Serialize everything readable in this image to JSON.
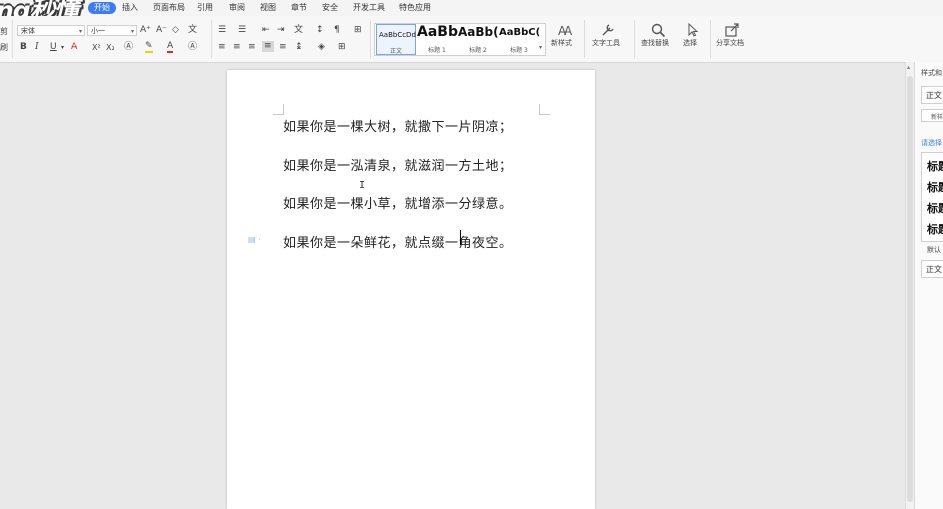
{
  "watermark": "ng秒懂",
  "menu": {
    "items": [
      "开始",
      "插入",
      "页面布局",
      "引用",
      "审阅",
      "视图",
      "章节",
      "安全",
      "开发工具",
      "特色应用"
    ],
    "active": "开始"
  },
  "ribbon": {
    "left_stub_top": "剪",
    "left_stub_bottom": "刷",
    "font_name": "宋体",
    "font_size": "小一",
    "grow_font": "A⁺",
    "shrink_font": "A⁻",
    "bold": "B",
    "italic": "I",
    "underline": "U",
    "font_color": "A",
    "superscript": "X²",
    "subscript": "X₂",
    "styles": [
      {
        "sample": "AaBbCcDd",
        "name": "正文"
      },
      {
        "sample": "AaBb",
        "name": "标题 1"
      },
      {
        "sample": "AaBb(",
        "name": "标题 2"
      },
      {
        "sample": "AaBbC(",
        "name": "标题 3"
      }
    ],
    "new_style": "新样式",
    "text_tool": "文字工具",
    "find_replace": "查找替换",
    "select": "选择",
    "share_doc": "分享文档"
  },
  "document": {
    "paragraphs": [
      "如果你是一棵大树，就撒下一片阴凉；",
      "如果你是一泓清泉，就滋润一方土地；",
      "如果你是一棵小草，就增添一分绿意。",
      "如果你是一朵鲜花，就点缀一角夜空。"
    ]
  },
  "side_panel": {
    "title": "样式和",
    "current_style": "正文",
    "new_button": "新样",
    "choose_label": "请选择",
    "headings": [
      "标题",
      "标题",
      "标题",
      "标题"
    ],
    "default_label": "默认",
    "bottom_style": "正文"
  },
  "colors": {
    "accent": "#3d7cf0",
    "font_color_red": "#e02b2b",
    "highlight_yellow": "#f5d000"
  }
}
